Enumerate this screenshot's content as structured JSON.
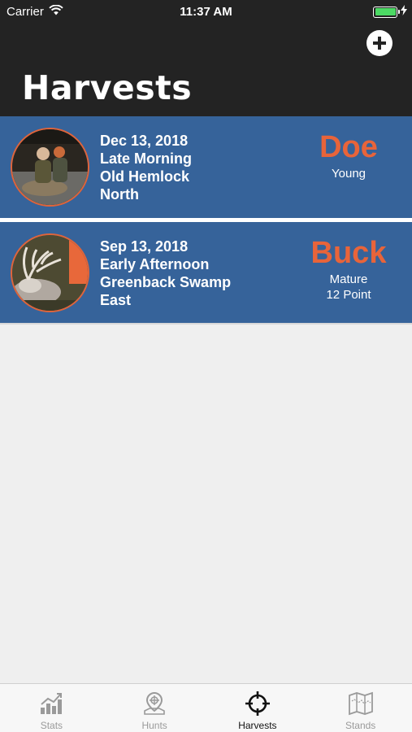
{
  "status": {
    "carrier": "Carrier",
    "time": "11:37 AM"
  },
  "header": {
    "title": "Harvests"
  },
  "harvests": [
    {
      "date": "Dec 13, 2018",
      "time_of_day": "Late Morning",
      "stand": "Old Hemlock",
      "wind": "North",
      "type": "Doe",
      "age": "Young",
      "points": ""
    },
    {
      "date": "Sep 13, 2018",
      "time_of_day": "Early Afternoon",
      "stand": "Greenback Swamp",
      "wind": "East",
      "type": "Buck",
      "age": "Mature",
      "points": "12 Point"
    }
  ],
  "tabs": [
    {
      "label": "Stats",
      "icon": "stats-icon"
    },
    {
      "label": "Hunts",
      "icon": "hunts-icon"
    },
    {
      "label": "Harvests",
      "icon": "crosshair-icon",
      "active": true
    },
    {
      "label": "Stands",
      "icon": "map-icon"
    }
  ],
  "colors": {
    "header": "#232323",
    "card": "#36639a",
    "accent": "#e8643a",
    "battery": "#4cd964"
  }
}
